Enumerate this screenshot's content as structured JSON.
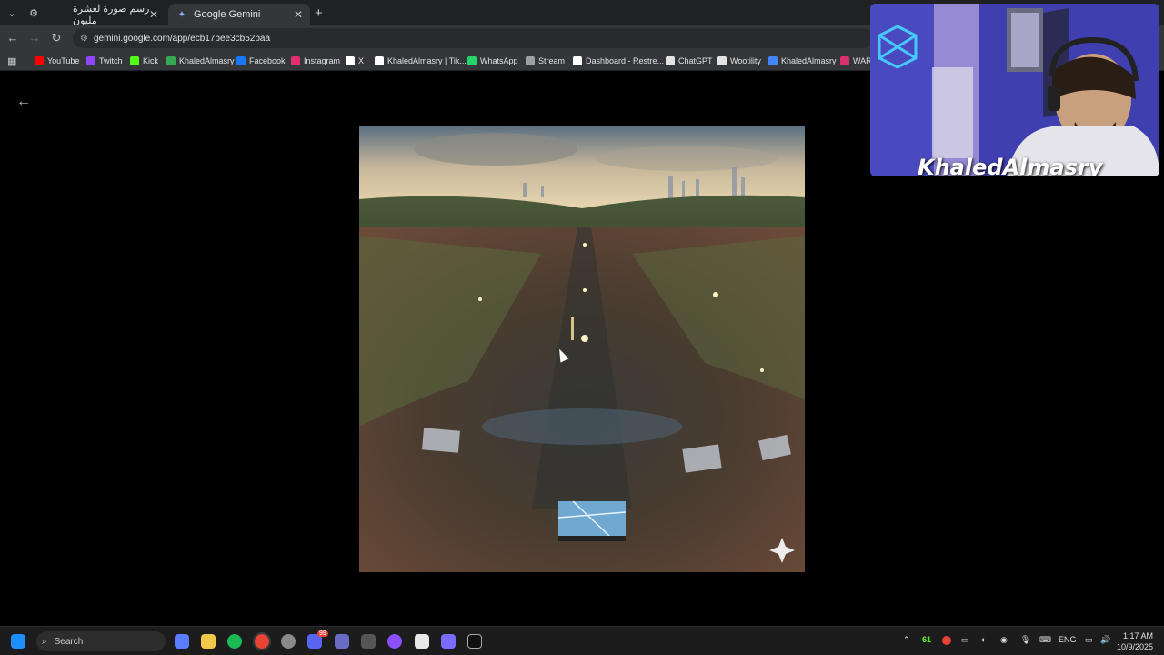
{
  "browser": {
    "tabs": [
      {
        "title": "رسم صورة لعشرة مليون",
        "active": false
      },
      {
        "title": "Google Gemini",
        "active": true
      }
    ],
    "url": "gemini.google.com/app/ecb17bee3cb52baa",
    "bookmarks": [
      {
        "label": "YouTube",
        "color": "#ff0000"
      },
      {
        "label": "Twitch",
        "color": "#9146ff"
      },
      {
        "label": "Kick",
        "color": "#53fc18"
      },
      {
        "label": "KhaledAlmasry",
        "color": "#34a853"
      },
      {
        "label": "Facebook",
        "color": "#1877f2"
      },
      {
        "label": "Instagram",
        "color": "#e1306c"
      },
      {
        "label": "X",
        "color": "#ffffff"
      },
      {
        "label": "KhaledAlmasry | Tik...",
        "color": "#ffffff"
      },
      {
        "label": "WhatsApp",
        "color": "#25d366"
      },
      {
        "label": "Stream",
        "color": "#9aa0a6"
      },
      {
        "label": "Dashboard - Restre...",
        "color": "#ffffff"
      },
      {
        "label": "ChatGPT",
        "color": "#e3e3e3"
      },
      {
        "label": "Wootility",
        "color": "#e3e3e3"
      },
      {
        "label": "KhaledAlmasry",
        "color": "#4285f4"
      },
      {
        "label": "WARZ",
        "color": "#d6336c"
      }
    ]
  },
  "webcam": {
    "overlay_name": "KhaledAlmasry"
  },
  "taskbar": {
    "search_placeholder": "Search",
    "temperature": "61",
    "language": "ENG",
    "time": "1:17 AM",
    "date": "10/9/2025",
    "discord_badge": "99"
  },
  "icons": {
    "back": "arrow-left-icon",
    "sparkle": "sparkle-icon"
  }
}
